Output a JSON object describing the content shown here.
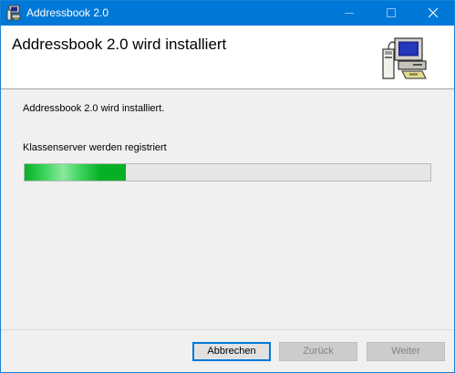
{
  "window": {
    "title": "Addressbook 2.0"
  },
  "header": {
    "title": "Addressbook 2.0 wird installiert"
  },
  "main": {
    "intro": "Addressbook 2.0 wird installiert.",
    "status": "Klassenserver werden registriert",
    "progress": 0.25
  },
  "buttons": {
    "cancel": "Abbrechen",
    "back": "Zurück",
    "next": "Weiter"
  },
  "colors": {
    "titlebar": "#0078d7",
    "progress_fill": "#06b025",
    "progress_track": "#e6e6e6",
    "focus_border": "#0078d7"
  },
  "icons": {
    "app": "installer-computer-icon",
    "header": "setup-computer-icon",
    "minimize": "minimize-icon",
    "maximize": "maximize-icon",
    "close": "close-icon"
  }
}
